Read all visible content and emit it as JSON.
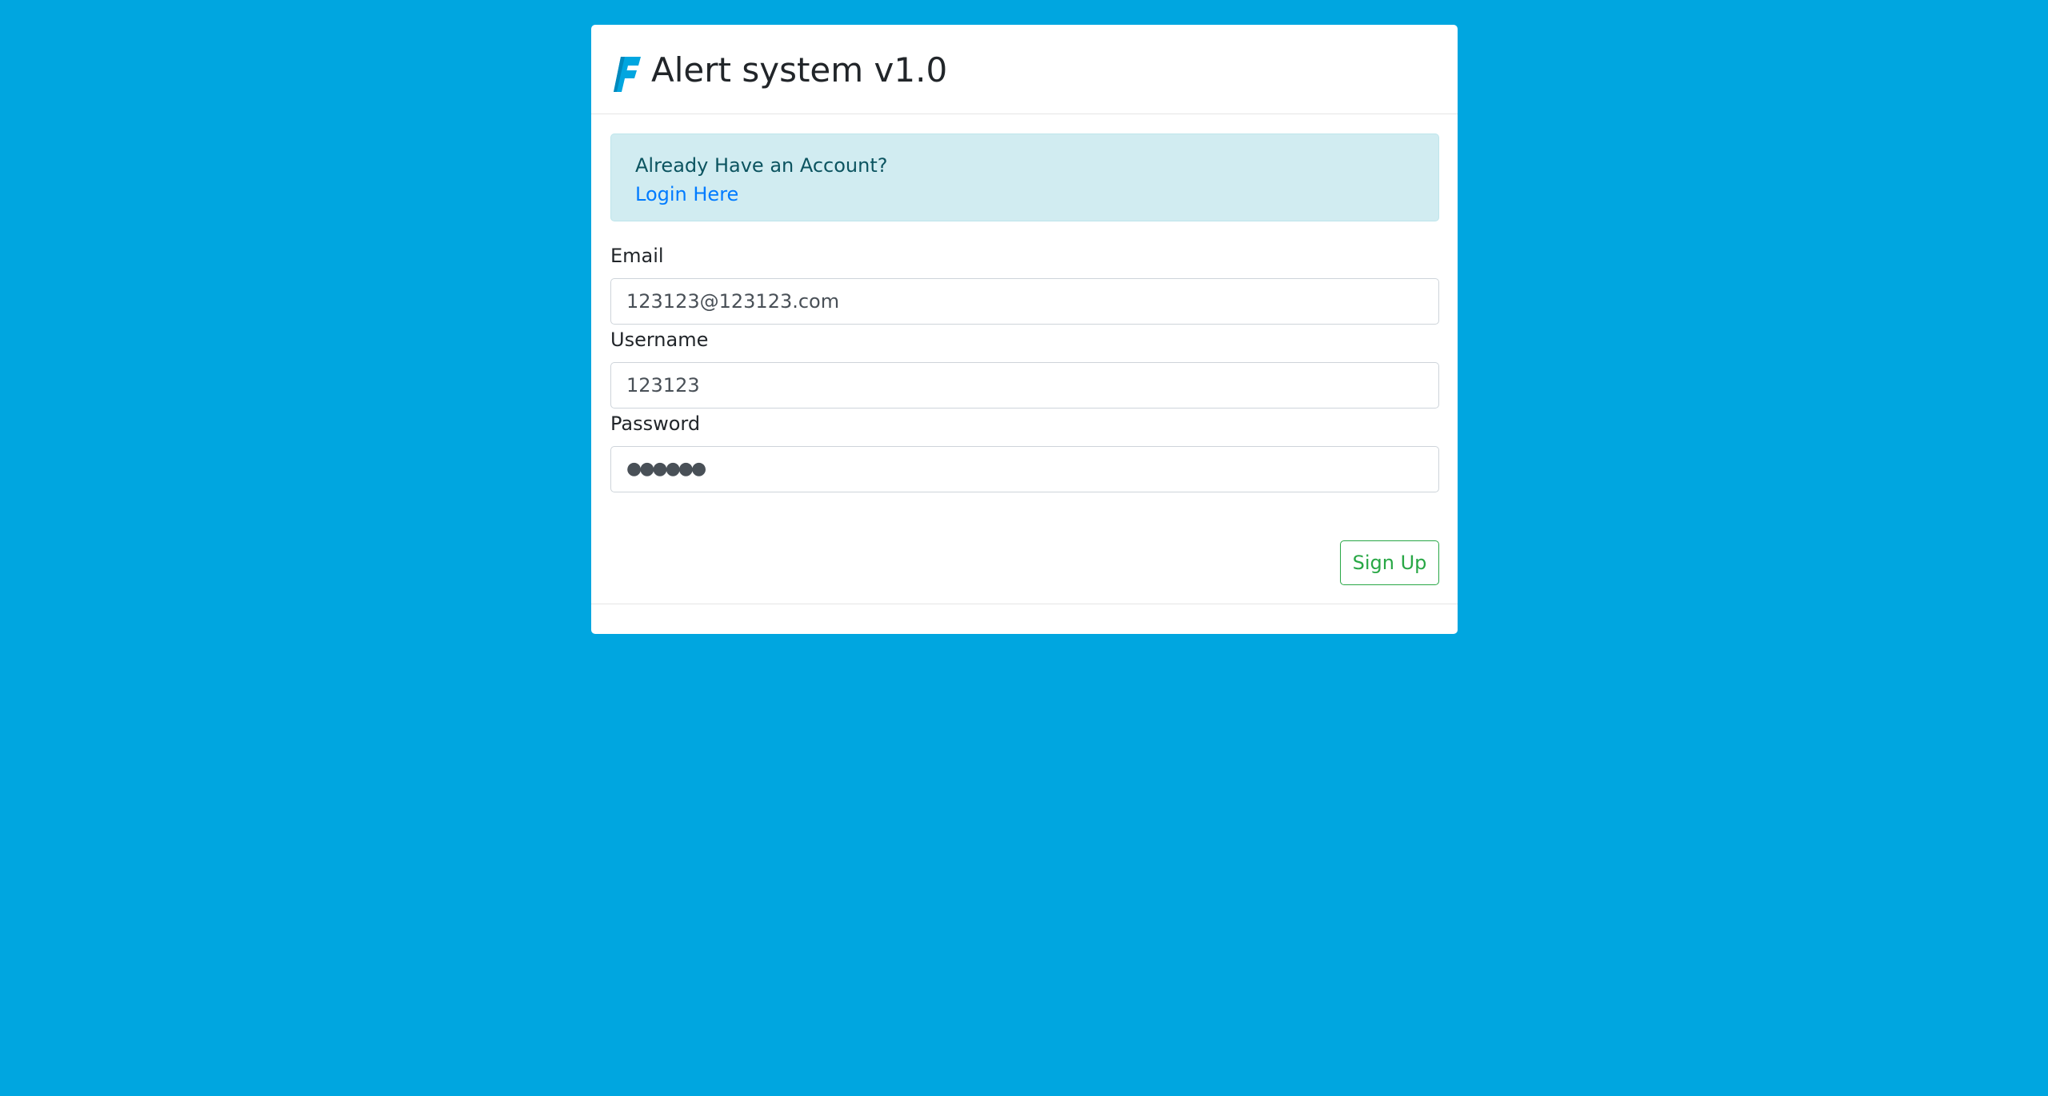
{
  "header": {
    "title": "Alert system v1.0",
    "logo_icon": "f-logo-icon",
    "logo_color": "#00a6e0"
  },
  "alert": {
    "text": "Already Have an Account?",
    "link_label": "Login Here"
  },
  "form": {
    "email": {
      "label": "Email",
      "value": "123123@123123.com"
    },
    "username": {
      "label": "Username",
      "value": "123123"
    },
    "password": {
      "label": "Password",
      "masked_value": "●●●●●●"
    },
    "submit_label": "Sign Up"
  },
  "colors": {
    "background": "#00a6e0",
    "alert_bg": "#d1ecf1",
    "link": "#007bff",
    "success": "#28a745"
  }
}
